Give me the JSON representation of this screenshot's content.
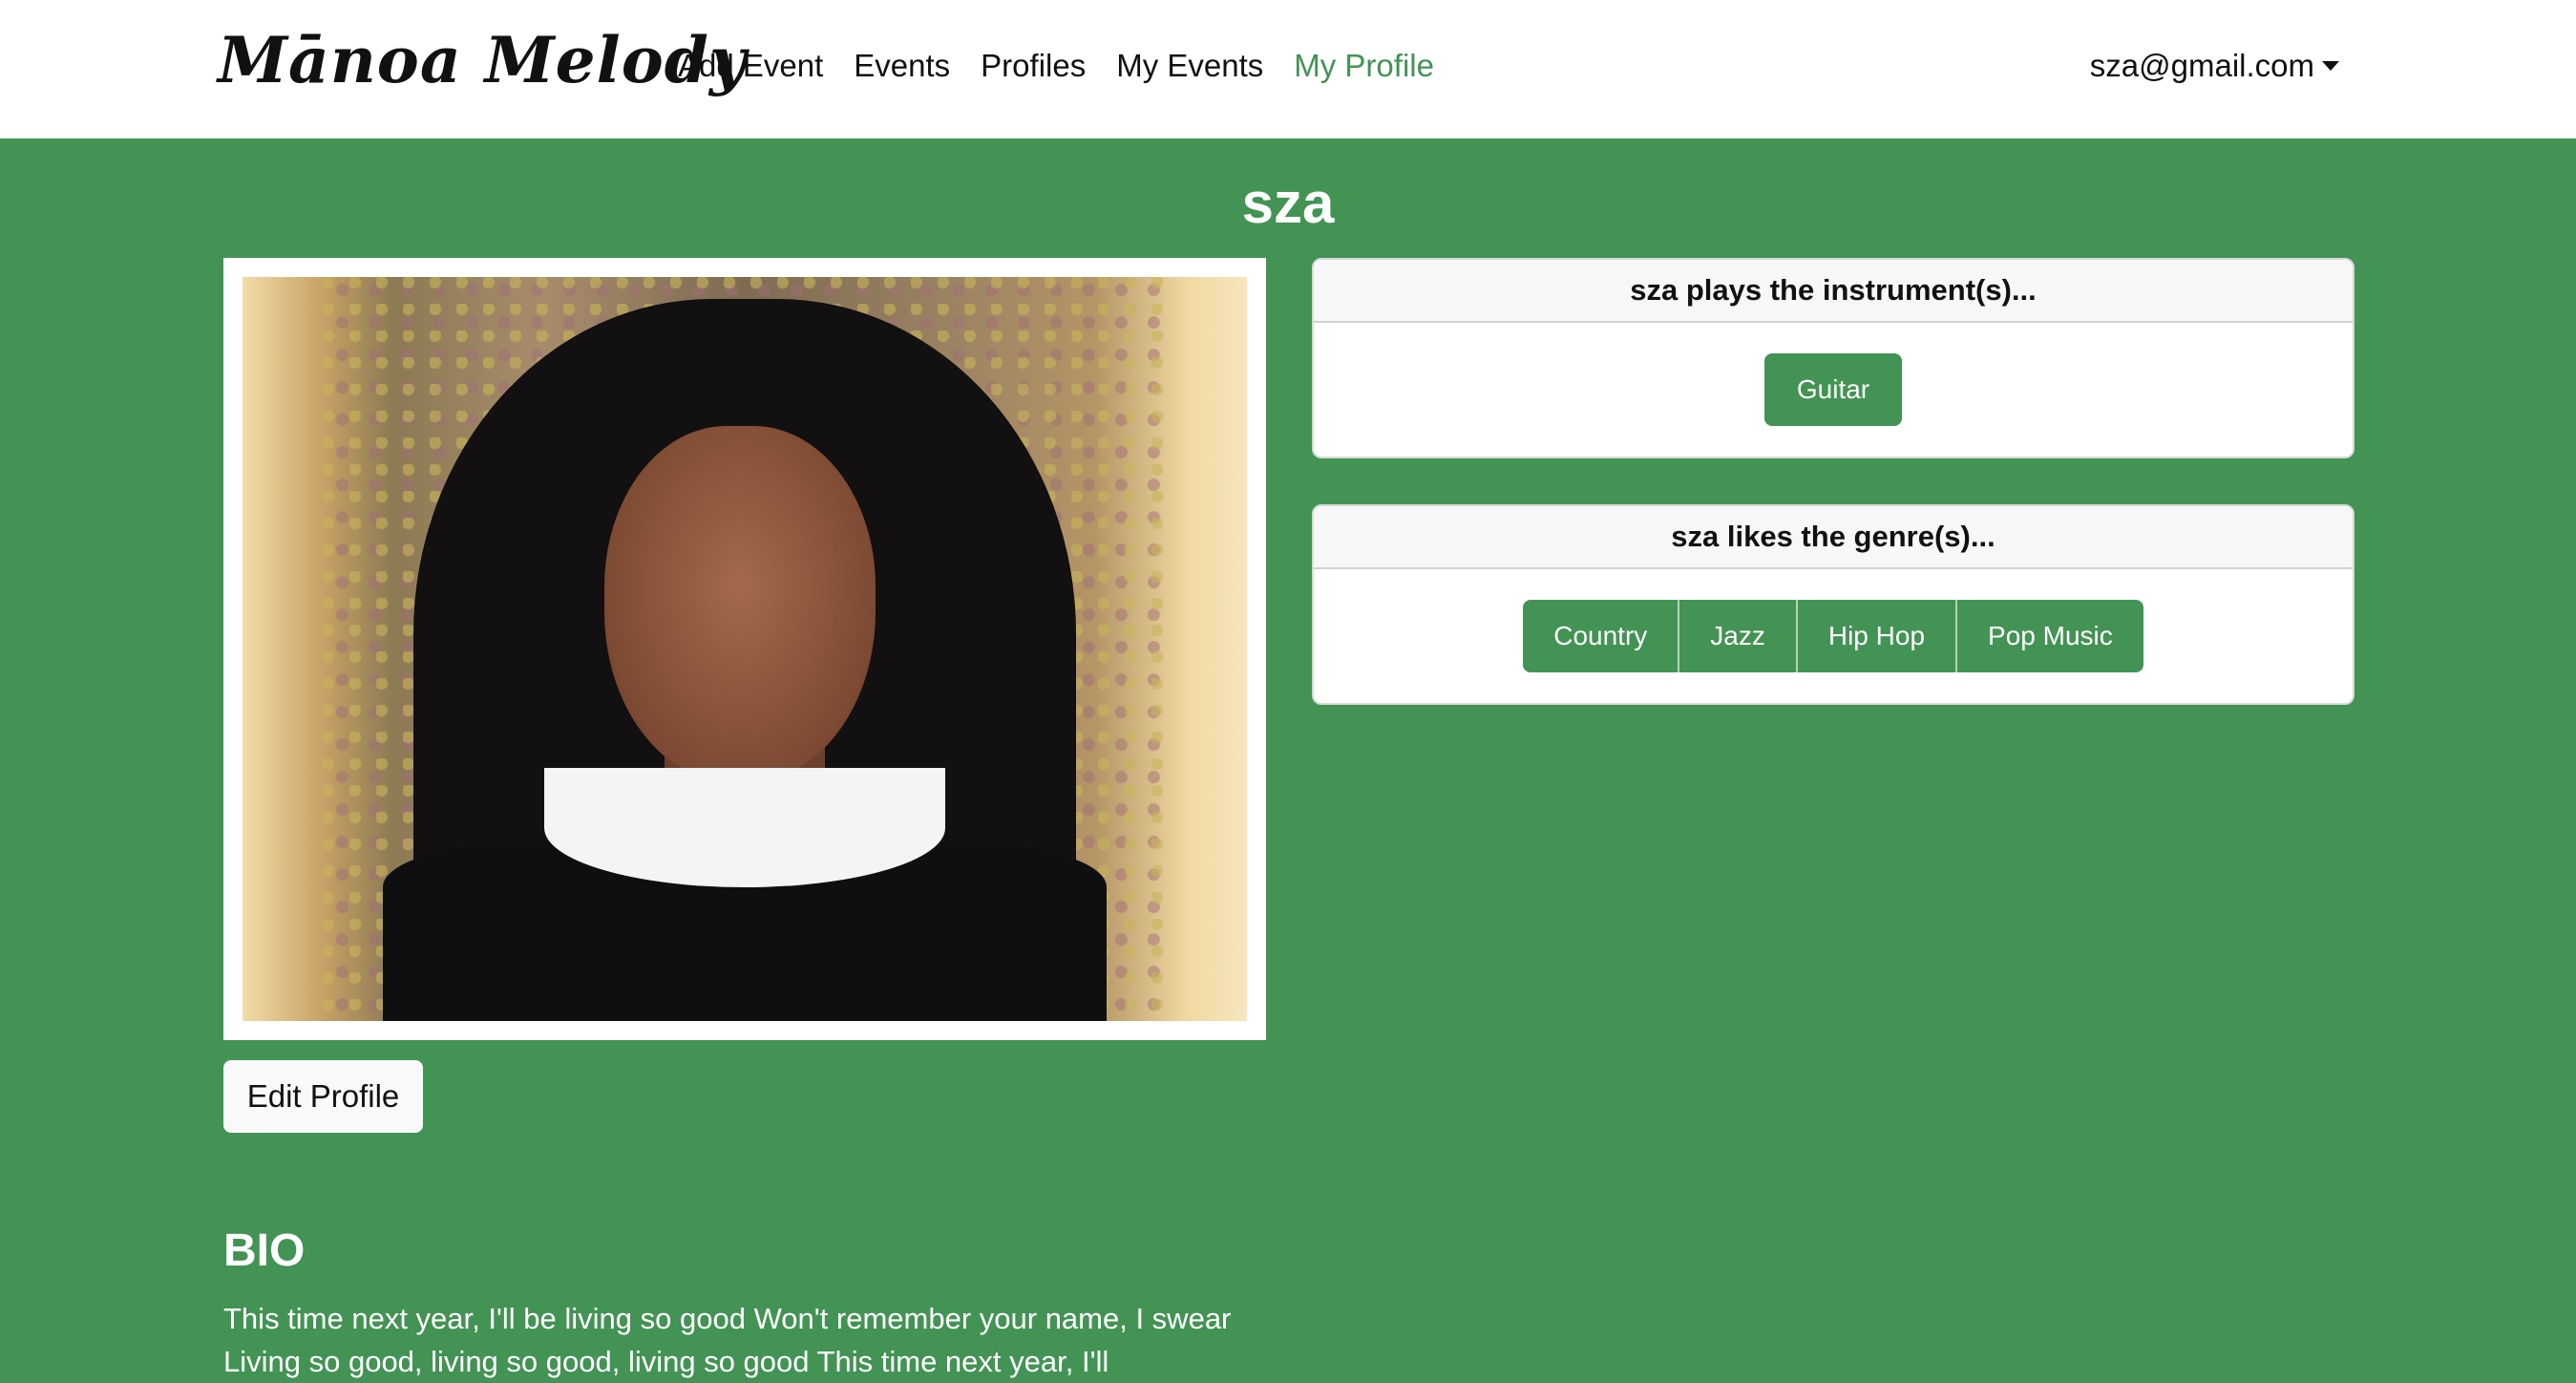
{
  "navbar": {
    "brand": "Mānoa Melody",
    "links": [
      {
        "label": "Add Event",
        "active": false
      },
      {
        "label": "Events",
        "active": false
      },
      {
        "label": "Profiles",
        "active": false
      },
      {
        "label": "My Events",
        "active": false
      },
      {
        "label": "My Profile",
        "active": true
      }
    ],
    "user_email": "sza@gmail.com"
  },
  "profile": {
    "name": "sza",
    "edit_label": "Edit Profile",
    "bio_title": "BIO",
    "bio_text": "This time next year, I'll be living so good Won't remember your name, I swear Living so good, living so good, living so good This time next year, I'll"
  },
  "instruments_card": {
    "header": "sza plays the instrument(s)...",
    "items": [
      "Guitar"
    ]
  },
  "genres_card": {
    "header": "sza likes the genre(s)...",
    "items": [
      "Country",
      "Jazz",
      "Hip Hop",
      "Pop Music"
    ]
  },
  "colors": {
    "page_background": "#439354",
    "accent": "#439354",
    "navbar": "#ffffff"
  }
}
